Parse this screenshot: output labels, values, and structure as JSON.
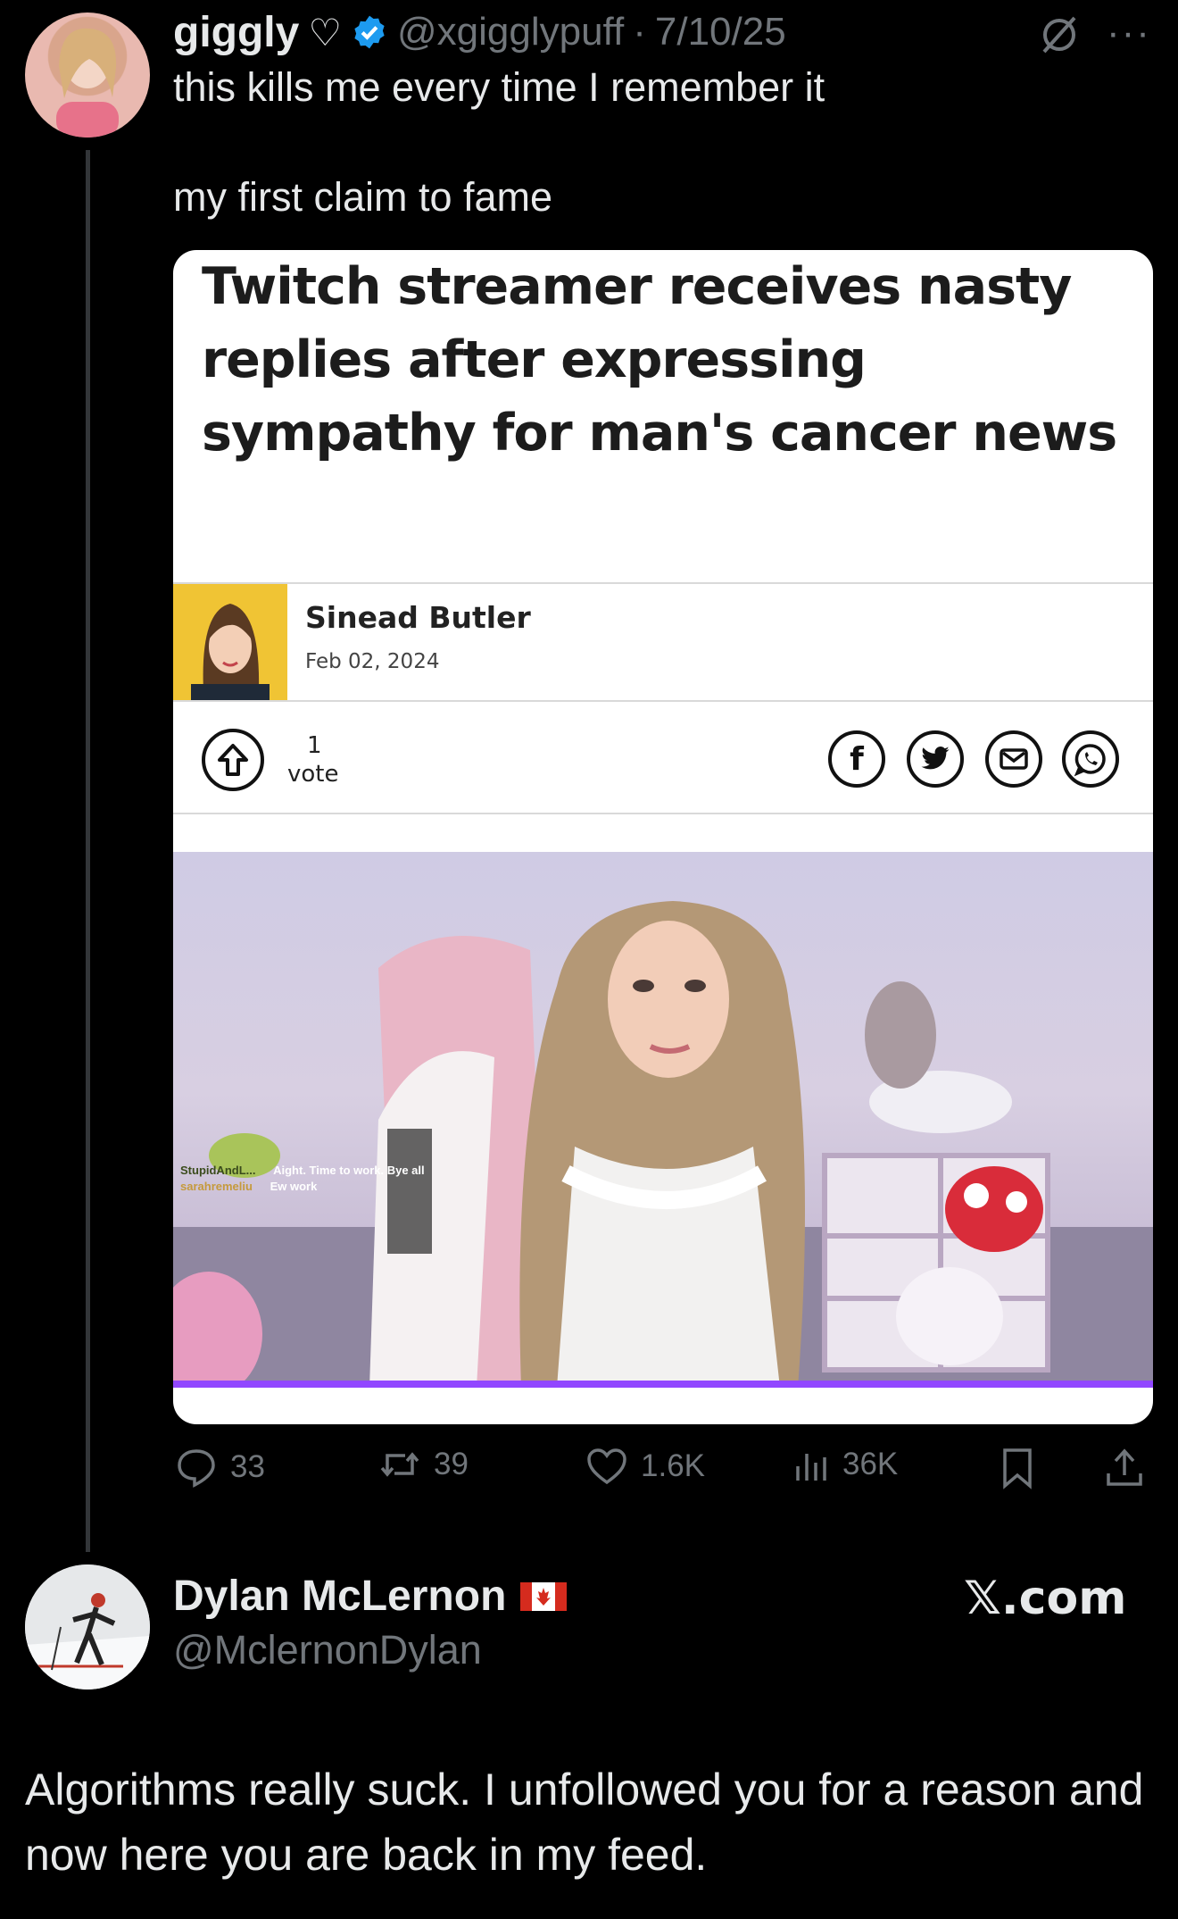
{
  "post": {
    "display_name": "giggly",
    "name_emoji": "♡",
    "handle": "@xgigglypuff",
    "separator": "·",
    "date": "7/10/25",
    "text_line1": "this kills me every time I remember it",
    "text_line2": "my first claim to fame"
  },
  "card": {
    "headline": "Twitch streamer receives nasty replies after expressing sympathy for man's cancer news",
    "author_name": "Sinead Butler",
    "author_date": "Feb 02, 2024",
    "vote_count": "1",
    "vote_label": "vote",
    "share_icons": [
      "facebook-icon",
      "twitter-icon",
      "email-icon",
      "whatsapp-icon"
    ],
    "stream_chat": {
      "user1": "StupidAndL...",
      "msg1": "Aight. Time to work. Bye all",
      "user2": "sarahremeliu",
      "msg2": "Ew work"
    }
  },
  "metrics": {
    "replies": "33",
    "reposts": "39",
    "likes": "1.6K",
    "views": "36K"
  },
  "reply": {
    "display_name": "Dylan McLernon",
    "flag": "🇨🇦",
    "handle": "@MclernonDylan",
    "brand": "𝕏.com",
    "text": "Algorithms really suck. I unfollowed you for a reason and now here you are back in my feed."
  },
  "colors": {
    "background": "#000000",
    "text": "#e7e9ea",
    "muted": "#71767b",
    "verified": "#1d9bf0"
  }
}
